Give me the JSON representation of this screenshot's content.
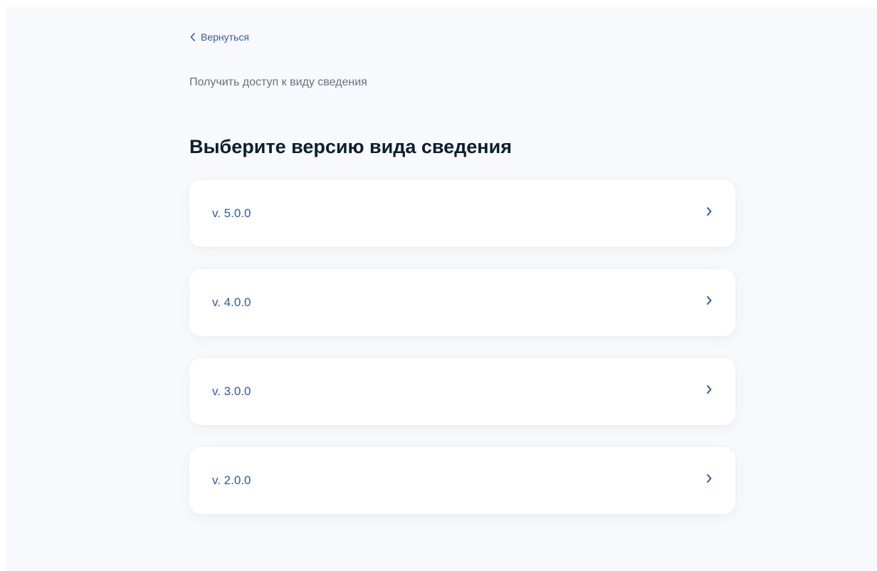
{
  "back_link": {
    "label": "Вернуться",
    "icon": "chevron-left-icon"
  },
  "subtitle": "Получить доступ к виду сведения",
  "title": "Выберите версию вида сведения",
  "versions": [
    {
      "label": "v. 5.0.0",
      "icon": "chevron-right-icon"
    },
    {
      "label": "v. 4.0.0",
      "icon": "chevron-right-icon"
    },
    {
      "label": "v. 3.0.0",
      "icon": "chevron-right-icon"
    },
    {
      "label": "v. 2.0.0",
      "icon": "chevron-right-icon"
    }
  ],
  "colors": {
    "accent": "#2d5bb0",
    "title": "#0b1f33",
    "muted": "#66727f",
    "page_background": "#f8f9fc",
    "card_background": "#ffffff"
  }
}
